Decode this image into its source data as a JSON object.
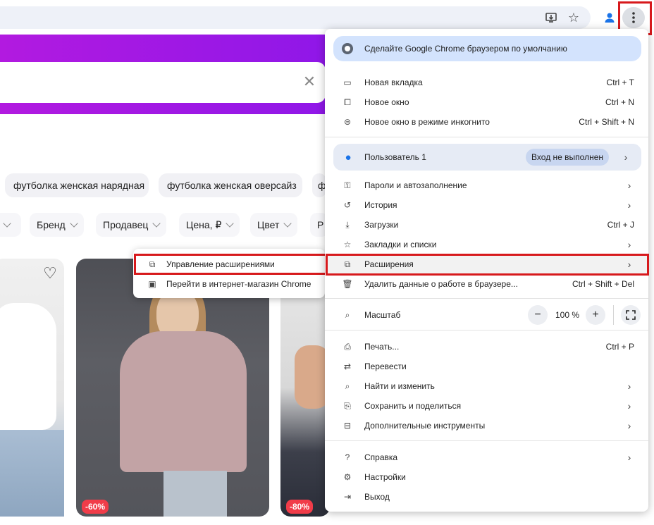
{
  "browser": {
    "icons": {
      "install": "install-icon",
      "bookmark": "star-icon",
      "profile": "person-icon",
      "menu": "three-dots-vertical-icon"
    }
  },
  "site": {
    "search_clear": "✕",
    "chips": [
      "футболка женская нарядная",
      "футболка женская оверсайз",
      "ф"
    ],
    "filters": [
      "Бренд",
      "Продавец",
      "Цена, ₽",
      "Цвет",
      "Р"
    ],
    "badges": [
      "-60%",
      "-80%"
    ]
  },
  "extensions_submenu": {
    "items": [
      {
        "label": "Управление расширениями",
        "icon": "puzzle-icon"
      },
      {
        "label": "Перейти в интернет-магазин Chrome",
        "icon": "web-store-icon"
      }
    ]
  },
  "chrome_menu": {
    "default_banner": "Сделайте Google Chrome браузером по умолчанию",
    "group1": [
      {
        "label": "Новая вкладка",
        "shortcut": "Ctrl + T",
        "icon": "new-tab-icon"
      },
      {
        "label": "Новое окно",
        "shortcut": "Ctrl + N",
        "icon": "new-window-icon"
      },
      {
        "label": "Новое окно в режиме инкогнито",
        "shortcut": "Ctrl + Shift + N",
        "icon": "incognito-icon"
      }
    ],
    "profile": {
      "label": "Пользователь 1",
      "status": "Вход не выполнен"
    },
    "group2": [
      {
        "label": "Пароли и автозаполнение",
        "shortcut": "",
        "arrow": true,
        "icon": "key-icon"
      },
      {
        "label": "История",
        "shortcut": "",
        "arrow": true,
        "icon": "history-icon"
      },
      {
        "label": "Загрузки",
        "shortcut": "Ctrl + J",
        "arrow": false,
        "icon": "download-icon"
      },
      {
        "label": "Закладки и списки",
        "shortcut": "",
        "arrow": true,
        "icon": "star-icon"
      },
      {
        "label": "Расширения",
        "shortcut": "",
        "arrow": true,
        "icon": "puzzle-icon"
      },
      {
        "label": "Удалить данные о работе в браузере...",
        "shortcut": "Ctrl + Shift + Del",
        "arrow": false,
        "icon": "trash-icon"
      }
    ],
    "zoom": {
      "label": "Масштаб",
      "value": "100 %",
      "minus": "−",
      "plus": "+"
    },
    "group3": [
      {
        "label": "Печать...",
        "shortcut": "Ctrl + P",
        "arrow": false,
        "icon": "print-icon"
      },
      {
        "label": "Перевести",
        "shortcut": "",
        "arrow": false,
        "icon": "translate-icon"
      },
      {
        "label": "Найти и изменить",
        "shortcut": "",
        "arrow": true,
        "icon": "find-icon"
      },
      {
        "label": "Сохранить и поделиться",
        "shortcut": "",
        "arrow": true,
        "icon": "save-share-icon"
      },
      {
        "label": "Дополнительные инструменты",
        "shortcut": "",
        "arrow": true,
        "icon": "toolbox-icon"
      }
    ],
    "group4": [
      {
        "label": "Справка",
        "shortcut": "",
        "arrow": true,
        "icon": "help-icon"
      },
      {
        "label": "Настройки",
        "shortcut": "",
        "arrow": false,
        "icon": "gear-icon"
      },
      {
        "label": "Выход",
        "shortcut": "",
        "arrow": false,
        "icon": "exit-icon"
      }
    ]
  },
  "colors": {
    "accent_blue": "#d3e3fd",
    "highlight_red": "#d7191c",
    "site_purple": "#9b18e6",
    "badge_red": "#f13c49"
  }
}
